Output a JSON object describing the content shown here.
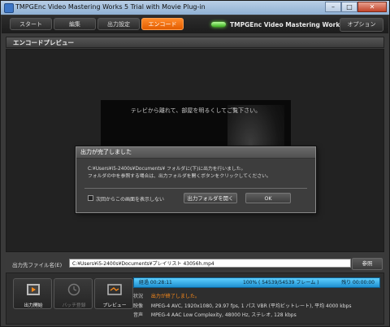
{
  "window": {
    "title": "TMPGEnc Video Mastering Works 5 Trial with Movie Plug-in",
    "minimize": "–",
    "maximize": "□",
    "close": "✕"
  },
  "toolbar": {
    "tabs": [
      "スタート",
      "編集",
      "出力設定",
      "エンコード"
    ],
    "active_tab": 3,
    "brand": "TMPGEnc Video Mastering Works 5",
    "options": "オプション",
    "accent": "#ff7a12"
  },
  "section": {
    "title": "エンコードプレビュー"
  },
  "preview": {
    "caption": "テレビから離れて、部屋を明るくしてご覧下さい。"
  },
  "dialog": {
    "title": "出力が完了しました",
    "line1": "C:¥Users¥i5-2400s¥Documents¥ フォルダに(下)に出力を行いました。",
    "line2": "フォルダの中を参照する場合は、出力フォルダを開くボタンをクリックしてください。",
    "checkbox_label": "次回からこの画面を表示しない",
    "checkbox_checked": false,
    "open_folder_button": "出力フォルダを開く",
    "ok_button": "OK"
  },
  "output": {
    "label": "出力先ファイル名(E)",
    "path": "C:¥Users¥i5-2400s¥Documents¥プレイリスト 43056h.mp4",
    "browse": "参照"
  },
  "actions": [
    {
      "label": "出力開始",
      "icon": "film-output-icon",
      "enabled": true
    },
    {
      "label": "バッチ登録",
      "icon": "clock-icon",
      "enabled": false
    },
    {
      "label": "プレビュー",
      "icon": "preview-icon",
      "enabled": true
    }
  ],
  "progress": {
    "elapsed": "経過 00:28:11",
    "percent": "100% ( 54539/54539 フレーム )",
    "remaining": "残り 00:00:00",
    "fill": 1.0
  },
  "info": {
    "status_key": "状況",
    "status_value": "出力が終了しました。",
    "video_key": "映像",
    "video_value": "MPEG-4 AVC, 1920x1080, 29.97 fps, 1 パス VBR (平均ビットレート), 平均 4000 kbps",
    "audio_key": "音声",
    "audio_value": "MPEG-4 AAC Low Complexity, 48000 Hz, ステレオ, 128 kbps"
  }
}
